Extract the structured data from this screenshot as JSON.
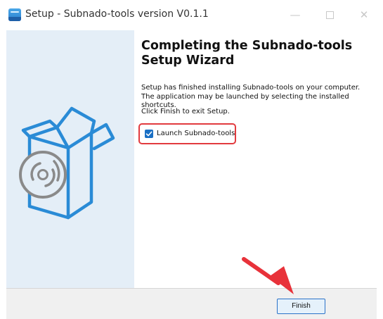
{
  "window": {
    "title": "Setup - Subnado-tools version V0.1.1",
    "app_icon": "installer-app-icon",
    "controls": {
      "minimize": "—",
      "close": "✕"
    }
  },
  "sidebar": {
    "illustration": "open-box-with-disc-icon",
    "colors": {
      "background": "#e4eef7",
      "box": "#2a8bd6",
      "disc": "#8a8a8a"
    }
  },
  "main": {
    "heading": "Completing the Subnado-tools Setup Wizard",
    "paragraph1": "Setup has finished installing Subnado-tools on your computer. The application may be launched by selecting the installed shortcuts.",
    "paragraph2": "Click Finish to exit Setup.",
    "launch_checkbox": {
      "label": "Launch Subnado-tools",
      "checked": true
    }
  },
  "footer": {
    "finish_label": "Finish"
  },
  "annotations": {
    "highlight_color": "#e23b3f",
    "arrow_color": "#e8323a"
  }
}
